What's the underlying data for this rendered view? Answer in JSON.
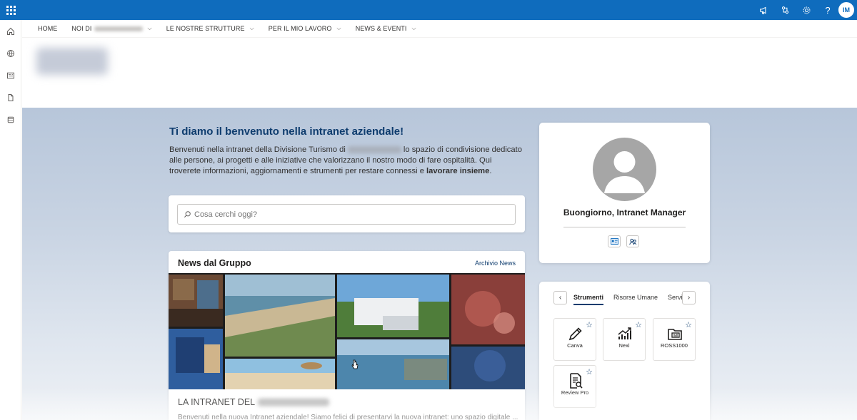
{
  "suite_bar": {
    "color": "#0f6cbd",
    "icons": [
      "megaphone-icon",
      "share-icon",
      "gear-icon",
      "help-icon"
    ],
    "help_label": "?",
    "avatar_initials": "IM"
  },
  "app_bar": {
    "icons": [
      "home-icon",
      "globe-icon",
      "news-icon",
      "file-icon",
      "list-icon"
    ]
  },
  "nav": {
    "items": [
      {
        "label": "HOME"
      },
      {
        "label": "NOI DI"
      },
      {
        "label": "LE NOSTRE STRUTTURE"
      },
      {
        "label": "PER IL MIO LAVORO"
      },
      {
        "label": "NEWS & EVENTI"
      }
    ]
  },
  "welcome": {
    "title": "Ti diamo il benvenuto nella intranet aziendale!",
    "text_part1": "Benvenuti nella intranet della Divisione Turismo di",
    "text_part2": "lo spazio di condivisione dedicato alle persone, ai progetti e alle iniziative che valorizzano il nostro modo di fare ospitalità. Qui troverete informazioni, aggiornamenti e strumenti per restare connessi e",
    "text_bold": "lavorare insieme",
    "text_end": "."
  },
  "search": {
    "placeholder": "Cosa cerchi oggi?"
  },
  "news": {
    "title": "News dal Gruppo",
    "archive_label": "Archivio News",
    "item_title": "LA INTRANET DEL",
    "item_text": "Benvenuti nella nuova Intranet aziendale! Siamo felici di presentarvi la nuova intranet: uno spazio digitale ..."
  },
  "profile": {
    "greeting": "Buongiorno, Intranet Manager"
  },
  "tools": {
    "tabs": [
      "Strumenti",
      "Risorse Umane",
      "Servi"
    ],
    "active_tab": "Strumenti",
    "items": [
      {
        "label": "Canva",
        "icon": "pencil-icon"
      },
      {
        "label": "Nexi",
        "icon": "chart-up-icon"
      },
      {
        "label": "ROSS1000",
        "icon": "folder-icon"
      },
      {
        "label": "Review Pro",
        "icon": "document-search-icon"
      }
    ],
    "star_glyph": "☆",
    "prev_glyph": "‹",
    "next_glyph": "›"
  },
  "colors": {
    "accent": "#0e3c6e",
    "brand": "#0f6cbd"
  }
}
